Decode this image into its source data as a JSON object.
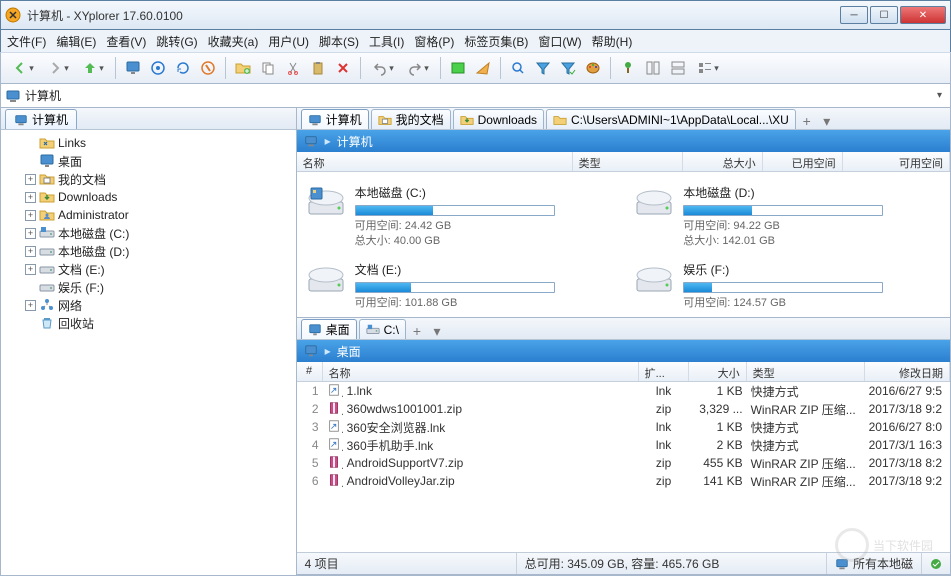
{
  "window": {
    "title": "计算机 - XYplorer 17.60.0100"
  },
  "menu": {
    "file": "文件(F)",
    "edit": "编辑(E)",
    "view": "查看(V)",
    "goto": "跳转(G)",
    "favorites": "收藏夹(a)",
    "user": "用户(U)",
    "script": "脚本(S)",
    "tools": "工具(I)",
    "panes": "窗格(P)",
    "tabsets": "标签页集(B)",
    "window": "窗口(W)",
    "help": "帮助(H)"
  },
  "address": {
    "text": "计算机"
  },
  "tree": {
    "tab": "计算机",
    "items": [
      {
        "indent": 0,
        "exp": "none",
        "icon": "link",
        "label": "Links"
      },
      {
        "indent": 0,
        "exp": "none",
        "icon": "desktop",
        "label": "桌面"
      },
      {
        "indent": 0,
        "exp": "plus",
        "icon": "folder-docs",
        "label": "我的文档"
      },
      {
        "indent": 0,
        "exp": "plus",
        "icon": "folder-dl",
        "label": "Downloads"
      },
      {
        "indent": 0,
        "exp": "plus",
        "icon": "folder-user",
        "label": "Administrator"
      },
      {
        "indent": 0,
        "exp": "plus",
        "icon": "drive-c",
        "label": "本地磁盘 (C:)"
      },
      {
        "indent": 0,
        "exp": "plus",
        "icon": "drive",
        "label": "本地磁盘 (D:)"
      },
      {
        "indent": 0,
        "exp": "plus",
        "icon": "drive",
        "label": "文档 (E:)"
      },
      {
        "indent": 0,
        "exp": "none",
        "icon": "drive",
        "label": "娱乐 (F:)"
      },
      {
        "indent": 0,
        "exp": "plus",
        "icon": "network",
        "label": "网络"
      },
      {
        "indent": 0,
        "exp": "none",
        "icon": "recycle",
        "label": "回收站"
      }
    ]
  },
  "top_pane": {
    "tabs": [
      {
        "label": "计算机",
        "icon": "computer",
        "active": true
      },
      {
        "label": "我的文档",
        "icon": "folder-docs"
      },
      {
        "label": "Downloads",
        "icon": "folder-dl"
      },
      {
        "label": "C:\\Users\\ADMINI~1\\AppData\\Local...\\XU",
        "icon": "folder"
      }
    ],
    "breadcrumb": {
      "label": "计算机"
    },
    "columns": {
      "name": "名称",
      "type": "类型",
      "total": "总大小",
      "used": "已用空间",
      "free": "可用空间"
    },
    "drives": [
      {
        "name": "本地磁盘 (C:)",
        "free_label": "可用空间:",
        "free": "24.42 GB",
        "total_label": "总大小:",
        "total": "40.00 GB",
        "pct_used": 39
      },
      {
        "name": "本地磁盘 (D:)",
        "free_label": "可用空间:",
        "free": "94.22 GB",
        "total_label": "总大小:",
        "total": "142.01 GB",
        "pct_used": 34
      },
      {
        "name": "文档 (E:)",
        "free_label": "可用空间:",
        "free": "101.88 GB",
        "total_label": "",
        "total": "",
        "pct_used": 28
      },
      {
        "name": "娱乐 (F:)",
        "free_label": "可用空间:",
        "free": "124.57 GB",
        "total_label": "",
        "total": "",
        "pct_used": 14
      }
    ]
  },
  "bottom_pane": {
    "tabs": [
      {
        "label": "桌面",
        "icon": "desktop",
        "active": true
      },
      {
        "label": "C:\\",
        "icon": "drive-c"
      }
    ],
    "breadcrumb": {
      "label": "桌面"
    },
    "columns": {
      "idx": "#",
      "name": "名称",
      "ext": "扩...",
      "size": "大小",
      "type": "类型",
      "date": "修改日期"
    },
    "rows": [
      {
        "idx": "1",
        "icon": "lnk",
        "name": "1.lnk",
        "ext": "lnk",
        "size": "1 KB",
        "type": "快捷方式",
        "date": "2016/6/27 9:5"
      },
      {
        "idx": "2",
        "icon": "zip",
        "name": "360wdws1001001.zip",
        "ext": "zip",
        "size": "3,329 ...",
        "type": "WinRAR ZIP 压缩...",
        "date": "2017/3/18 9:2"
      },
      {
        "idx": "3",
        "icon": "lnk",
        "name": "360安全浏览器.lnk",
        "ext": "lnk",
        "size": "1 KB",
        "type": "快捷方式",
        "date": "2016/6/27 8:0"
      },
      {
        "idx": "4",
        "icon": "lnk",
        "name": "360手机助手.lnk",
        "ext": "lnk",
        "size": "2 KB",
        "type": "快捷方式",
        "date": "2017/3/1 16:3"
      },
      {
        "idx": "5",
        "icon": "zip",
        "name": "AndroidSupportV7.zip",
        "ext": "zip",
        "size": "455 KB",
        "type": "WinRAR ZIP 压缩...",
        "date": "2017/3/18 8:2"
      },
      {
        "idx": "6",
        "icon": "zip",
        "name": "AndroidVolleyJar.zip",
        "ext": "zip",
        "size": "141 KB",
        "type": "WinRAR ZIP 压缩...",
        "date": "2017/3/18 9:2"
      }
    ]
  },
  "status": {
    "count": "4 项目",
    "usage": "总可用: 345.09 GB, 容量: 465.76 GB",
    "right": "所有本地磁"
  },
  "watermark": "当下软件园"
}
